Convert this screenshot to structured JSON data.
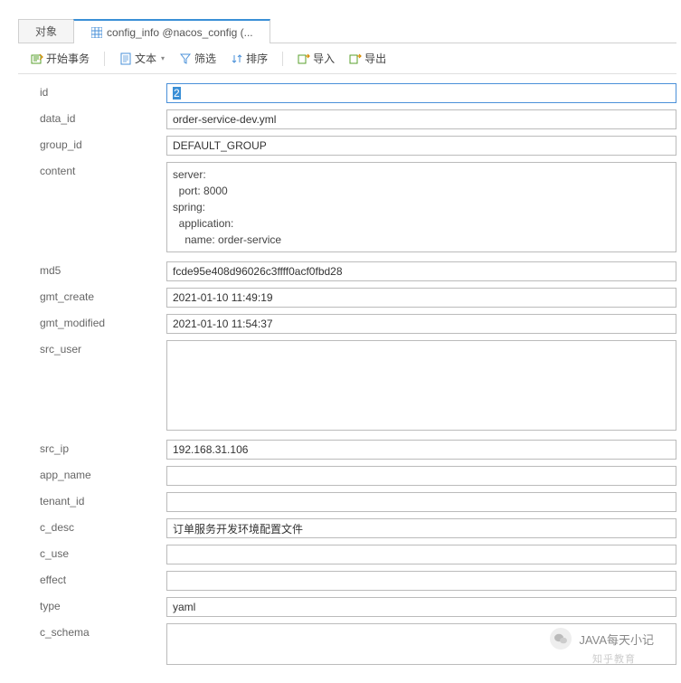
{
  "tabs": [
    {
      "label": "对象"
    },
    {
      "label": "config_info @nacos_config (..."
    }
  ],
  "toolbar": {
    "start_tx": "开始事务",
    "text": "文本",
    "filter": "筛选",
    "sort": "排序",
    "import": "导入",
    "export": "导出"
  },
  "fields": {
    "id": {
      "label": "id",
      "value": "2"
    },
    "data_id": {
      "label": "data_id",
      "value": "order-service-dev.yml"
    },
    "group_id": {
      "label": "group_id",
      "value": "DEFAULT_GROUP"
    },
    "content": {
      "label": "content",
      "value": "server:\n  port: 8000\nspring:\n  application:\n    name: order-service"
    },
    "md5": {
      "label": "md5",
      "value": "fcde95e408d96026c3ffff0acf0fbd28"
    },
    "gmt_create": {
      "label": "gmt_create",
      "value": "2021-01-10 11:49:19"
    },
    "gmt_modified": {
      "label": "gmt_modified",
      "value": "2021-01-10 11:54:37"
    },
    "src_user": {
      "label": "src_user",
      "value": ""
    },
    "src_ip": {
      "label": "src_ip",
      "value": "192.168.31.106"
    },
    "app_name": {
      "label": "app_name",
      "value": ""
    },
    "tenant_id": {
      "label": "tenant_id",
      "value": ""
    },
    "c_desc": {
      "label": "c_desc",
      "value": "订单服务开发环境配置文件"
    },
    "c_use": {
      "label": "c_use",
      "value": ""
    },
    "effect": {
      "label": "effect",
      "value": ""
    },
    "type": {
      "label": "type",
      "value": "yaml"
    },
    "c_schema": {
      "label": "c_schema",
      "value": ""
    }
  },
  "watermark": {
    "main": "JAVA每天小记",
    "sub": "知乎教育"
  }
}
